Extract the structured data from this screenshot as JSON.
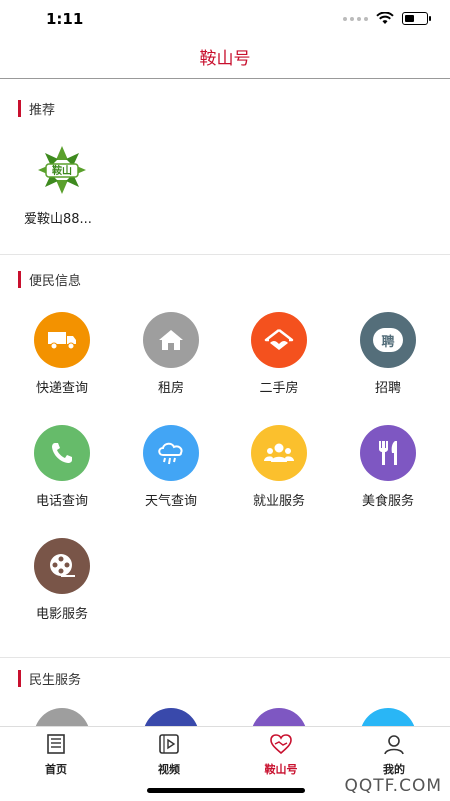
{
  "status": {
    "time": "1:11"
  },
  "header": {
    "title": "鞍山号"
  },
  "recommend": {
    "title": "推荐",
    "items": [
      {
        "label": "爱鞍山88...",
        "logo_text": "鞍山"
      }
    ]
  },
  "services": {
    "title": "便民信息",
    "items": [
      {
        "label": "快递查询",
        "icon": "truck-icon",
        "color": "#f39200"
      },
      {
        "label": "租房",
        "icon": "house-icon",
        "color": "#9e9e9e"
      },
      {
        "label": "二手房",
        "icon": "handshake-house-icon",
        "color": "#f4511e"
      },
      {
        "label": "招聘",
        "icon": "recruit-bubble-icon",
        "color": "#546e7a",
        "icon_text": "聘"
      },
      {
        "label": "电话查询",
        "icon": "phone-icon",
        "color": "#66bb6a"
      },
      {
        "label": "天气查询",
        "icon": "rain-cloud-icon",
        "color": "#42a5f5"
      },
      {
        "label": "就业服务",
        "icon": "people-icon",
        "color": "#fbc02d"
      },
      {
        "label": "美食服务",
        "icon": "fork-knife-icon",
        "color": "#7e57c2"
      },
      {
        "label": "电影服务",
        "icon": "film-reel-icon",
        "color": "#795548"
      }
    ]
  },
  "livelihood": {
    "title": "民生服务",
    "colors": [
      "#9e9e9e",
      "#3949ab",
      "#7e57c2",
      "#29b6f6"
    ]
  },
  "tabs": [
    {
      "label": "首页",
      "icon": "newspaper-icon"
    },
    {
      "label": "视频",
      "icon": "video-icon"
    },
    {
      "label": "鞍山号",
      "icon": "heart-hands-icon",
      "active": true
    },
    {
      "label": "我的",
      "icon": "user-icon"
    }
  ],
  "watermark": "QQTF.COM"
}
